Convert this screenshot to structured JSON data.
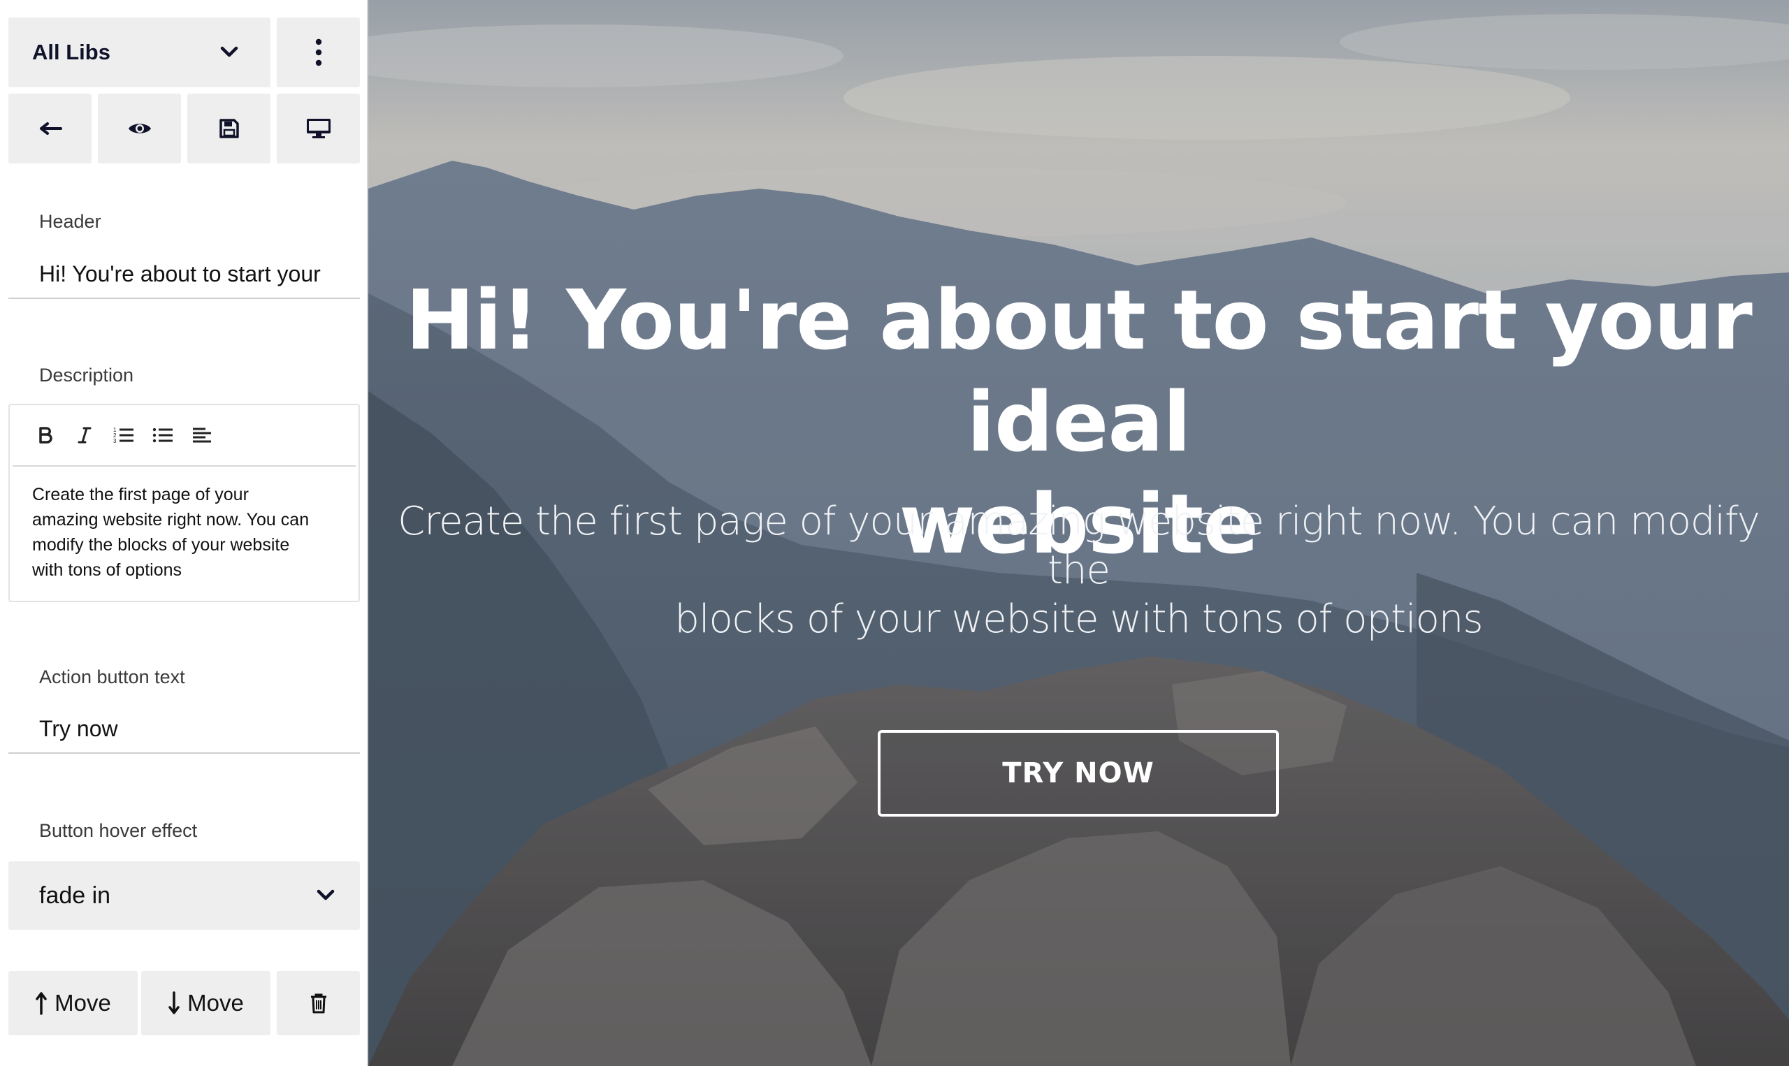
{
  "sidebar": {
    "library_select": {
      "selected": "All Libs",
      "icon": "chevron-down-icon"
    },
    "more_icon": "kebab-menu-icon",
    "toolbar": [
      {
        "name": "back",
        "icon": "arrow-left-icon"
      },
      {
        "name": "preview",
        "icon": "eye-icon"
      },
      {
        "name": "save",
        "icon": "floppy-disk-icon"
      },
      {
        "name": "device",
        "icon": "desktop-monitor-icon"
      }
    ],
    "header_field": {
      "label": "Header",
      "value": "Hi! You're about to start your"
    },
    "description_field": {
      "label": "Description",
      "toolbar": [
        "bold",
        "italic",
        "ordered-list",
        "unordered-list",
        "align-left"
      ],
      "lines": [
        "Create the first page of your",
        "amazing website right now. You can",
        "modify the blocks of your website",
        "with tons of options"
      ]
    },
    "action_field": {
      "label": "Action button text",
      "value": "Try now"
    },
    "hover_field": {
      "label": "Button hover effect",
      "selected": "fade in"
    },
    "footer": {
      "move_up": "Move",
      "move_down": "Move",
      "delete_icon": "trash-icon"
    }
  },
  "preview": {
    "title_lines": [
      "Hi! You're about to start your ideal",
      "website"
    ],
    "description_lines": [
      "Create the first page of your amazing website right now. You can modify the",
      "blocks of your website with tons of options"
    ],
    "button": "TRY NOW"
  },
  "colors": {
    "sidebar_tile": "#eeeeee",
    "dark_text": "#10122a",
    "hero_text": "#ffffff"
  }
}
